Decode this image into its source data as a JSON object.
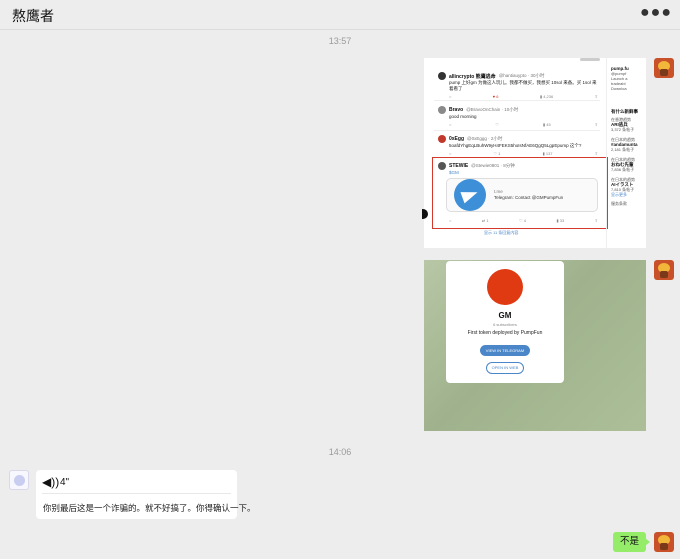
{
  "header": {
    "title": "熬鹰者",
    "more_icon": "more-icon"
  },
  "times": [
    "13:57",
    "14:06"
  ],
  "screenshot1": {
    "tweets": [
      {
        "name": "allincrypto 熊鹰逃命",
        "handle": "@hantiauypto · 30小时",
        "text": "pump 上好gm 为做这人玩儿。我都不做买，我想买 10sol 来备。买 1sol 来着看了",
        "stats": [
          "",
          "6",
          "4,236",
          ""
        ]
      },
      {
        "name": "Bravo",
        "handle": "@BravoOnChain · 10小时",
        "text": "good morning",
        "stats": [
          "",
          "",
          "45",
          ""
        ]
      },
      {
        "name": "0xEgg",
        "handle": "@0xEggg · 2小时",
        "text": "5oafdYhgEqLBuhW9yH4FEKS5hoIsNfAE6QgQ5LgpEpump 这个?",
        "stats": [
          "",
          "",
          "1",
          "137"
        ]
      },
      {
        "name": "STEWIE",
        "handle": "@Stewie0801 · 8分钟",
        "text": "$GM",
        "stats": [
          "",
          "1",
          "4",
          "33"
        ]
      }
    ],
    "link_card": {
      "domain": "t.me",
      "title": "Telegram: Contact @GMPumpFun"
    },
    "show_more": "显示 11 条回复内容",
    "sidebar": [
      {
        "label": "pump.fu",
        "bold": true
      },
      {
        "label": "@pumpf",
        "bold": false
      },
      {
        "label": "Launch a",
        "bold": false
      },
      {
        "label": "tradeabl",
        "bold": false
      },
      {
        "label": "Downloa",
        "bold": false
      },
      {
        "label": "有什么新鲜事",
        "bold": true
      },
      {
        "label": "在香港趋势",
        "bold": false
      },
      {
        "label": "ARI逃兵",
        "bold": true
      },
      {
        "label": "3,372 条帖子",
        "bold": false
      },
      {
        "label": "在日本的趋势",
        "bold": false
      },
      {
        "label": "#andamunta",
        "bold": true
      },
      {
        "label": "2,181 条帖子",
        "bold": false
      },
      {
        "label": "在日本的趋势",
        "bold": false
      },
      {
        "label": "おねむ先輩",
        "bold": true
      },
      {
        "label": "7,836 条帖子",
        "bold": false
      },
      {
        "label": "在日本的趋势",
        "bold": false
      },
      {
        "label": "AIイラスト",
        "bold": true
      },
      {
        "label": "7,810 条帖子",
        "bold": false
      },
      {
        "label": "显示更多",
        "bold": false
      },
      {
        "label": "服务条款",
        "bold": false
      }
    ]
  },
  "screenshot2": {
    "name": "GM",
    "subscribers": "6 subscribers",
    "description": "First token deployed by PumpFun",
    "view_button": "VIEW IN TELEGRAM",
    "open_button": "OPEN IN WEB"
  },
  "voice": {
    "icon": "voice-icon",
    "duration": "4\"",
    "transcript": "你别最后这是一个诈骗的。就不好搞了。你得确认一下。"
  },
  "reply": {
    "text": "不是"
  },
  "colors": {
    "bubble_green": "#95ec69",
    "accent_red": "#d33a2b",
    "telegram_blue": "#3d8fd8"
  }
}
